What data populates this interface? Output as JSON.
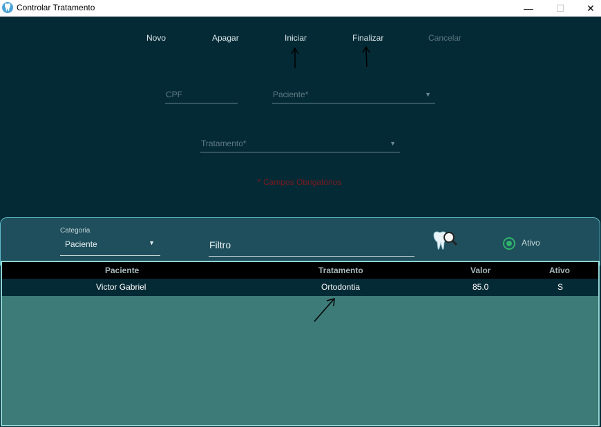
{
  "window": {
    "title": "Controlar Tratamento",
    "controls": {
      "minimize": "—",
      "maximize": "☐",
      "close": "✕"
    }
  },
  "toolbar": {
    "novo": "Novo",
    "apagar": "Apagar",
    "iniciar": "Iniciar",
    "finalizar": "Finalizar",
    "cancelar": "Cancelar"
  },
  "form": {
    "cpf_placeholder": "CPF",
    "paciente_placeholder": "Paciente*",
    "tratamento_placeholder": "Tratamento*",
    "required_note": "* Campos Obrigatórios"
  },
  "filter": {
    "category_label": "Categoria",
    "category_value": "Paciente",
    "filter_placeholder": "Filtro",
    "search_icon": "tooth-search-icon",
    "active_label": "Ativo",
    "active_checked": true
  },
  "table": {
    "columns": [
      "Paciente",
      "Tratamento",
      "Valor",
      "Ativo"
    ],
    "rows": [
      {
        "paciente": "Victor Gabriel",
        "tratamento": "Ortodontia",
        "valor": "85.0",
        "ativo": "S"
      }
    ]
  },
  "colors": {
    "background": "#042a35",
    "panel": "#1f4f5c",
    "table_body": "#3d7b78",
    "accent": "#2fb36a",
    "required": "#7a1a1f"
  }
}
